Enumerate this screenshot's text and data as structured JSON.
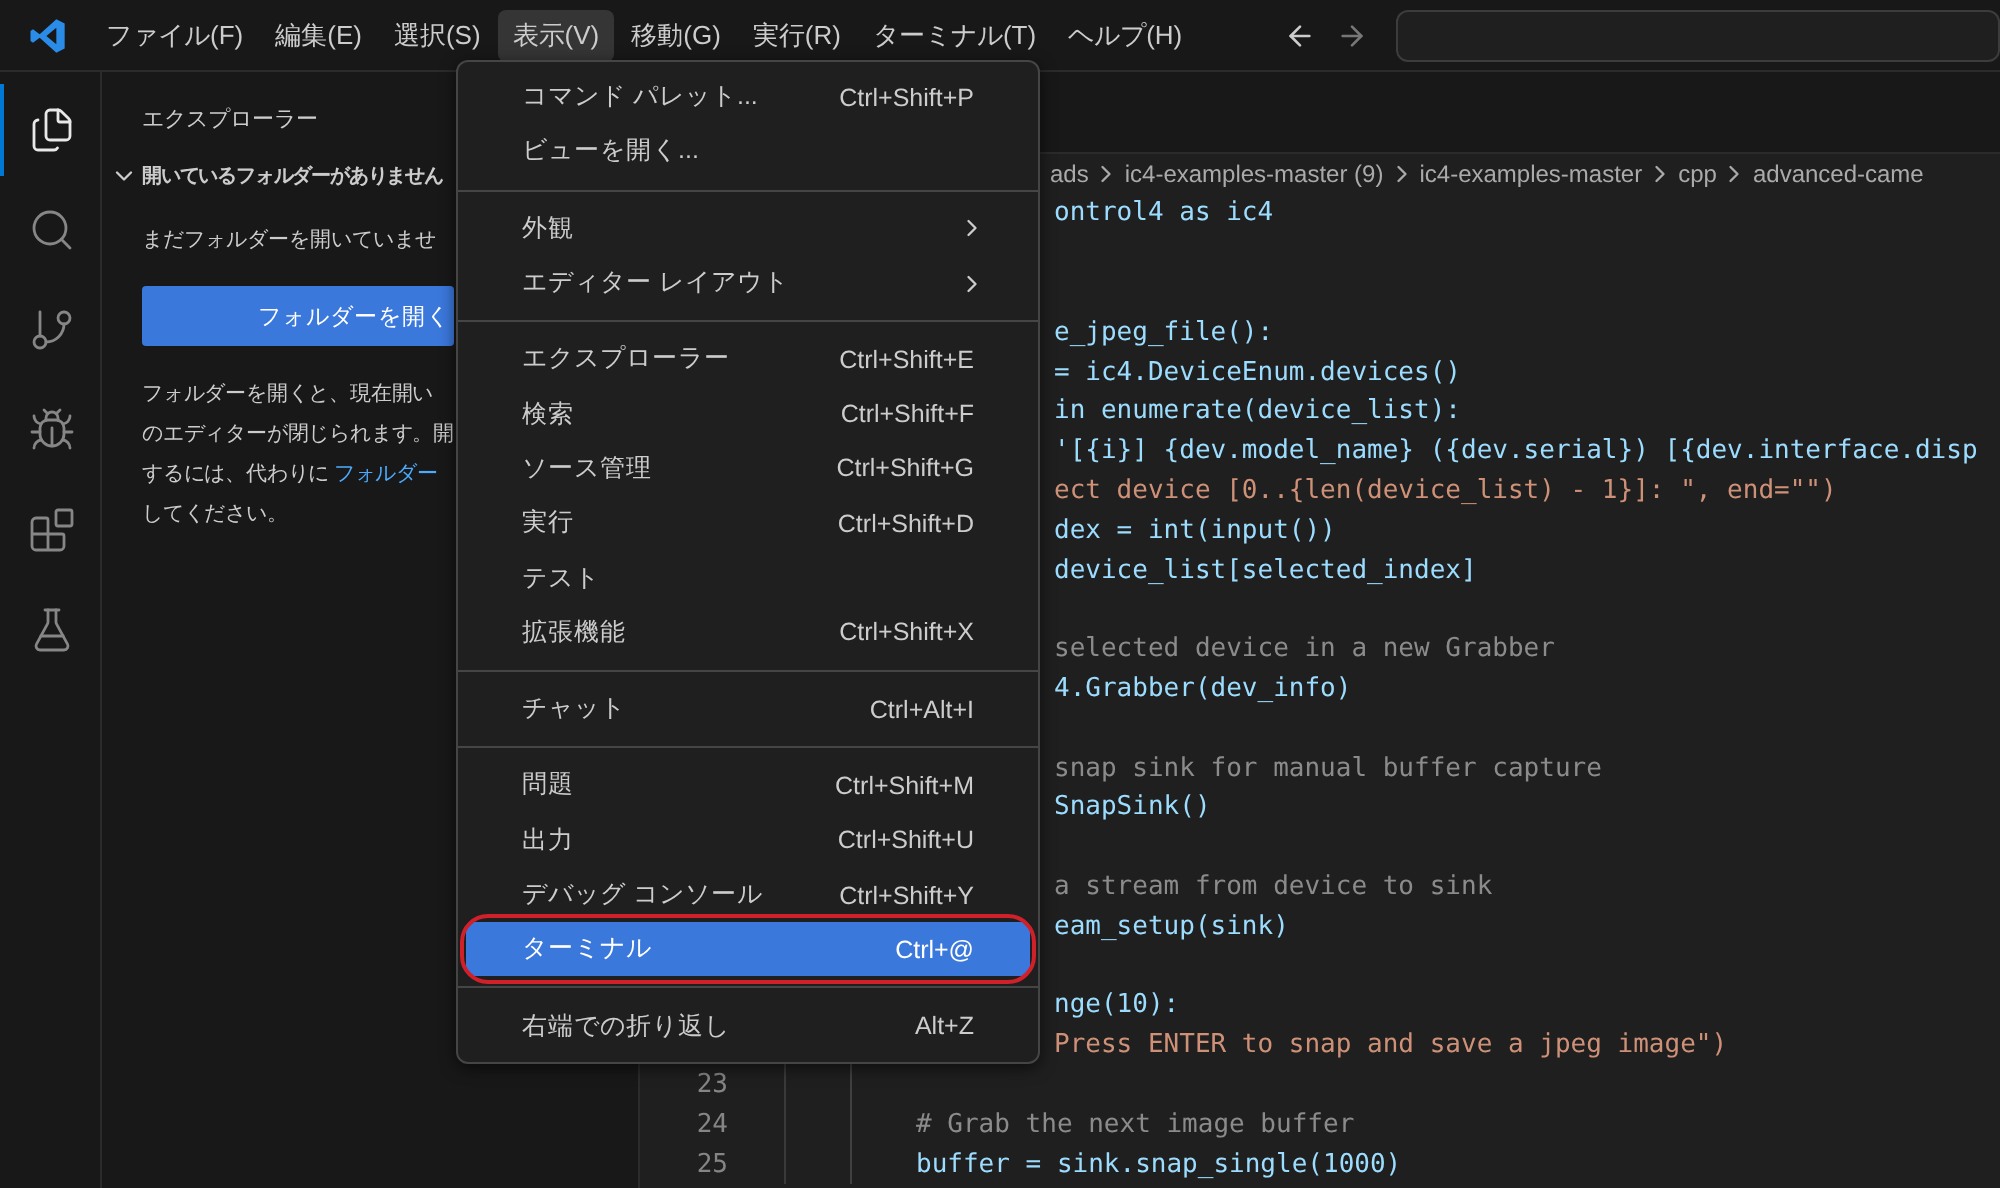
{
  "menubar": {
    "items": [
      {
        "label": "ファイル(F)",
        "selected": false
      },
      {
        "label": "編集(E)",
        "selected": false
      },
      {
        "label": "選択(S)",
        "selected": false
      },
      {
        "label": "表示(V)",
        "selected": true
      },
      {
        "label": "移動(G)",
        "selected": false
      },
      {
        "label": "実行(R)",
        "selected": false
      },
      {
        "label": "ターミナル(T)",
        "selected": false
      },
      {
        "label": "ヘルプ(H)",
        "selected": false
      }
    ]
  },
  "activity_bar": {
    "items": [
      {
        "kind": "explorer",
        "selected": true
      },
      {
        "kind": "search",
        "selected": false
      },
      {
        "kind": "source-control",
        "selected": false
      },
      {
        "kind": "run",
        "selected": false
      },
      {
        "kind": "extensions",
        "selected": false
      },
      {
        "kind": "testing",
        "selected": false
      }
    ]
  },
  "sidebar": {
    "title": "エクスプローラー",
    "section": {
      "title": "開いているフォルダーがありません",
      "expanded": true
    },
    "message": "まだフォルダーを開いていませ",
    "button": "フォルダーを開く",
    "description": [
      {
        "text": "フォルダーを開くと、現在開い"
      },
      {
        "text": "のエディターが閉じられます。開"
      },
      {
        "text": "するには、代わりに ",
        "link": "フォルダー"
      },
      {
        "text": "してください。"
      }
    ]
  },
  "breadcrumb": [
    "ads",
    "ic4-examples-master (9)",
    "ic4-examples-master",
    "cpp",
    "advanced-came"
  ],
  "code_lines": [
    {
      "text": "ontrol4 as ic4",
      "kind": "code"
    },
    {
      "kind": "blank"
    },
    {
      "kind": "blank"
    },
    {
      "text": "e_jpeg_file():",
      "kind": "code"
    },
    {
      "text": "= ic4.DeviceEnum.devices()",
      "kind": "code"
    },
    {
      "text": "in enumerate(device_list):",
      "kind": "code"
    },
    {
      "text": "'[{i}] {dev.model_name} ({dev.serial}) [{dev.interface.disp",
      "kind": "code"
    },
    {
      "text": "ect device [0..{len(device_list) - 1}]: \", end=\"\")",
      "kind": "string"
    },
    {
      "text": "dex = int(input())",
      "kind": "code"
    },
    {
      "text": "device_list[selected_index]",
      "kind": "code"
    },
    {
      "kind": "blank"
    },
    {
      "text": "selected device in a new Grabber",
      "kind": "comment"
    },
    {
      "text": "4.Grabber(dev_info)",
      "kind": "code"
    },
    {
      "kind": "blank"
    },
    {
      "text": "snap sink for manual buffer capture",
      "kind": "comment"
    },
    {
      "text": "SnapSink()",
      "kind": "code"
    },
    {
      "kind": "blank"
    },
    {
      "text": "a stream from device to sink",
      "kind": "comment"
    },
    {
      "text": "eam_setup(sink)",
      "kind": "code"
    },
    {
      "kind": "blank"
    },
    {
      "text": "nge(10):",
      "kind": "code"
    },
    {
      "text": "Press ENTER to snap and save a jpeg image\")",
      "kind": "string"
    },
    {
      "number": "23",
      "kind": "blank"
    },
    {
      "number": "24",
      "text": "# Grab the next image buffer",
      "kind": "comment"
    },
    {
      "number": "25",
      "text": "buffer = sink.snap_single(1000)",
      "kind": "code"
    }
  ],
  "view_menu": {
    "groups": [
      [
        {
          "label": "コマンド パレット...",
          "shortcut": "Ctrl+Shift+P",
          "selected": false
        },
        {
          "label": "ビューを開く...",
          "selected": false
        }
      ],
      [
        {
          "label": "外観",
          "submenu": true,
          "selected": false
        },
        {
          "label": "エディター レイアウト",
          "submenu": true,
          "selected": false
        }
      ],
      [
        {
          "label": "エクスプローラー",
          "shortcut": "Ctrl+Shift+E",
          "selected": false
        },
        {
          "label": "検索",
          "shortcut": "Ctrl+Shift+F",
          "selected": false
        },
        {
          "label": "ソース管理",
          "shortcut": "Ctrl+Shift+G",
          "selected": false
        },
        {
          "label": "実行",
          "shortcut": "Ctrl+Shift+D",
          "selected": false
        },
        {
          "label": "テスト",
          "selected": false
        },
        {
          "label": "拡張機能",
          "shortcut": "Ctrl+Shift+X",
          "selected": false
        }
      ],
      [
        {
          "label": "チャット",
          "shortcut": "Ctrl+Alt+I",
          "selected": false
        }
      ],
      [
        {
          "label": "問題",
          "shortcut": "Ctrl+Shift+M",
          "selected": false
        },
        {
          "label": "出力",
          "shortcut": "Ctrl+Shift+U",
          "selected": false
        },
        {
          "label": "デバッグ コンソール",
          "shortcut": "Ctrl+Shift+Y",
          "selected": false
        },
        {
          "label": "ターミナル",
          "shortcut": "Ctrl+@",
          "selected": true,
          "circled": true
        }
      ],
      [
        {
          "label": "右端での折り返し",
          "shortcut": "Alt+Z",
          "selected": false
        }
      ]
    ]
  }
}
